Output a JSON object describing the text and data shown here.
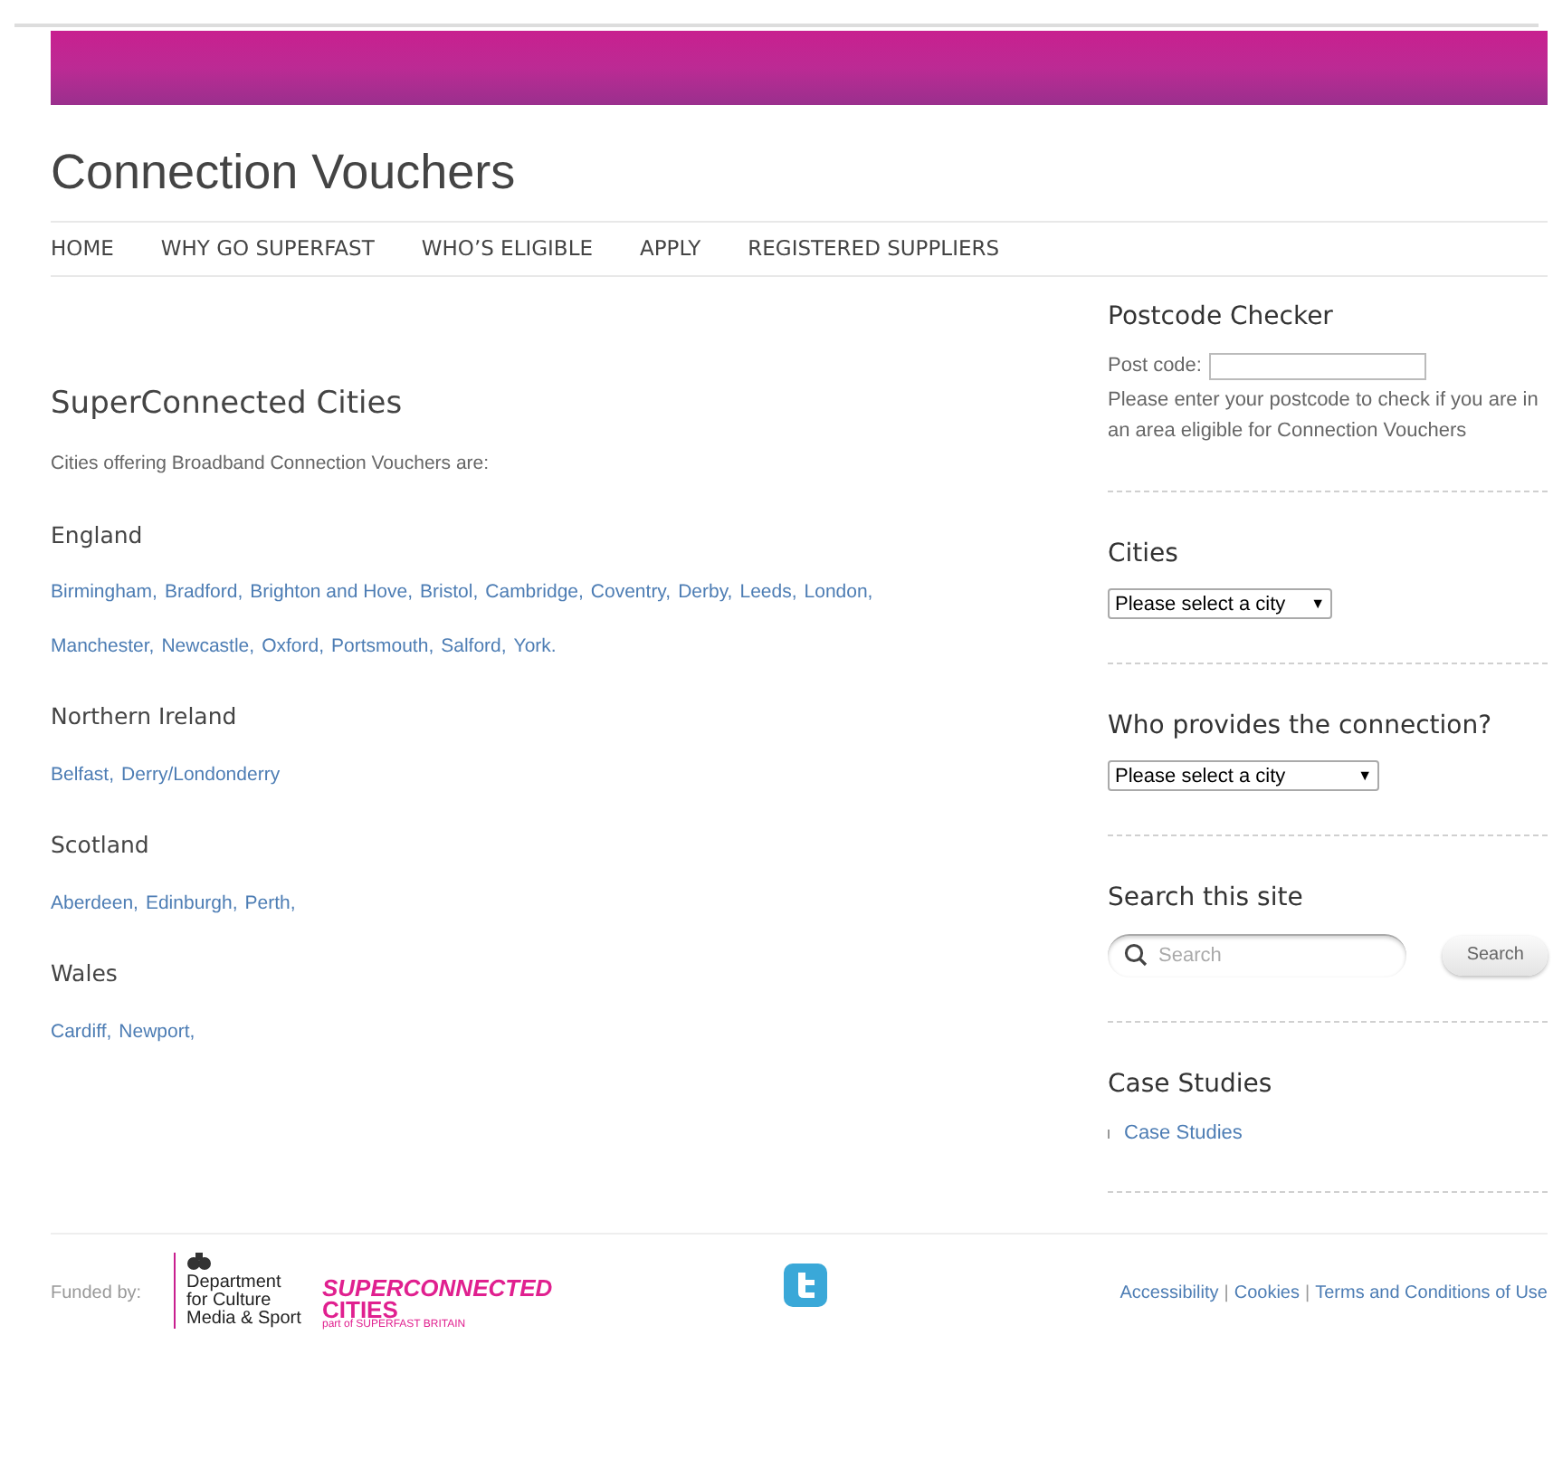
{
  "site_title": "Connection Vouchers",
  "nav": [
    {
      "label": "HOME"
    },
    {
      "label": "WHY GO SUPERFAST"
    },
    {
      "label": "WHO’S ELIGIBLE"
    },
    {
      "label": "APPLY"
    },
    {
      "label": "REGISTERED SUPPLIERS"
    }
  ],
  "main": {
    "heading": "SuperConnected Cities",
    "intro": "Cities offering Broadband Connection Vouchers are:",
    "regions": [
      {
        "name": "England",
        "lines": [
          [
            "Birmingham,",
            "Bradford,",
            "Brighton and Hove,",
            "Bristol,",
            "Cambridge,",
            "Coventry,",
            "Derby,",
            "Leeds,",
            "London,"
          ],
          [
            "Manchester,",
            "Newcastle,",
            "Oxford,",
            "Portsmouth,",
            "Salford,",
            "York."
          ]
        ]
      },
      {
        "name": "Northern Ireland",
        "lines": [
          [
            "Belfast,",
            "Derry/Londonderry"
          ]
        ]
      },
      {
        "name": "Scotland",
        "lines": [
          [
            "Aberdeen,",
            "Edinburgh,",
            "Perth,"
          ]
        ]
      },
      {
        "name": "Wales",
        "lines": [
          [
            "Cardiff,",
            "Newport,"
          ]
        ]
      }
    ]
  },
  "sidebar": {
    "widgets": [
      {
        "kind": "postcode",
        "title": "Postcode Checker",
        "label": "Post code:",
        "help": "Please enter your postcode to check if you are in an area eligible for Connection Vouchers"
      },
      {
        "kind": "select",
        "title": "Cities",
        "value": "Please select a city",
        "arrow": "▼"
      },
      {
        "kind": "select",
        "title": "Who provides the connection?",
        "value": "Please select a city",
        "arrow": "▼",
        "wide": true
      },
      {
        "kind": "search",
        "title": "Search this site",
        "placeholder": "Search",
        "button": "Search"
      },
      {
        "kind": "links",
        "title": "Case Studies",
        "items": [
          "Case Studies"
        ]
      }
    ]
  },
  "footer": {
    "funded_by": "Funded by:",
    "dept_lines": [
      "Department",
      "for Culture",
      "Media & Sport"
    ],
    "logo_top": "SUPERCONNECTED",
    "logo_bottom": "CITIES",
    "logo_sub": "part of SUPERFAST BRITAIN",
    "separator": "|",
    "links": [
      {
        "label": "Accessibility"
      },
      {
        "label": "Cookies"
      },
      {
        "label": "Terms and Conditions of Use"
      }
    ]
  }
}
